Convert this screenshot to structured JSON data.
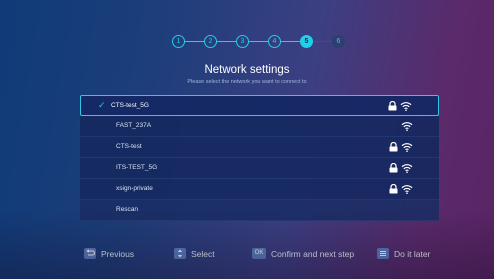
{
  "stepper": {
    "steps": [
      "1",
      "2",
      "3",
      "4",
      "5",
      "6"
    ],
    "active_step": "5"
  },
  "header": {
    "title": "Network settings",
    "subtitle": "Please select the network you want to connect to"
  },
  "networks": [
    {
      "ssid": "CTS-test_5G",
      "secured": true,
      "selected": true
    },
    {
      "ssid": "FAST_237A",
      "secured": false,
      "selected": false
    },
    {
      "ssid": "CTS-test",
      "secured": true,
      "selected": false
    },
    {
      "ssid": "ITS-TEST_5G",
      "secured": true,
      "selected": false
    },
    {
      "ssid": "xsign-private",
      "secured": true,
      "selected": false
    }
  ],
  "rescan_label": "Rescan",
  "footer": {
    "previous": "Previous",
    "select": "Select",
    "ok_key": "OK",
    "confirm": "Confirm and next step",
    "later": "Do it later"
  },
  "colors": {
    "accent": "#1fd0e8",
    "selection_border": "#34c6e2",
    "list_bg": "#16285f"
  },
  "icons": {
    "selected": "check-icon",
    "lock": "lock-icon",
    "wifi": "wifi-icon",
    "previous": "back-key-icon",
    "select": "updown-key-icon",
    "later": "menu-key-icon"
  }
}
